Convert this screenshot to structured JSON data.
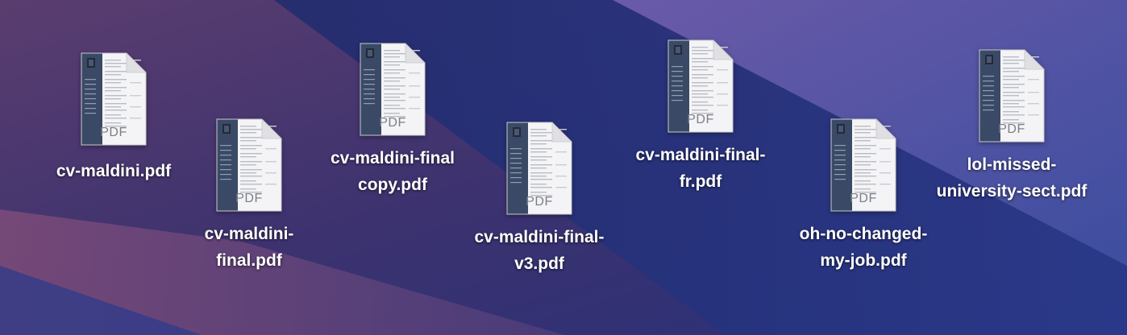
{
  "desktop": {
    "files": [
      {
        "name": "cv-maldini.pdf",
        "badge": "PDF"
      },
      {
        "name": "cv-maldini-final.pdf",
        "badge": "PDF"
      },
      {
        "name": "cv-maldini-final copy.pdf",
        "badge": "PDF"
      },
      {
        "name": "cv-maldini-final-v3.pdf",
        "badge": "PDF"
      },
      {
        "name": "cv-maldini-final-fr.pdf",
        "badge": "PDF"
      },
      {
        "name": "oh-no-changed-my-job.pdf",
        "badge": "PDF"
      },
      {
        "name": "lol-missed-university-sect.pdf",
        "badge": "PDF"
      }
    ]
  },
  "colors": {
    "wallpaper_top": "#2b3a86",
    "wallpaper_left": "#5a3a6e",
    "sidebar": "#3a4a66"
  }
}
